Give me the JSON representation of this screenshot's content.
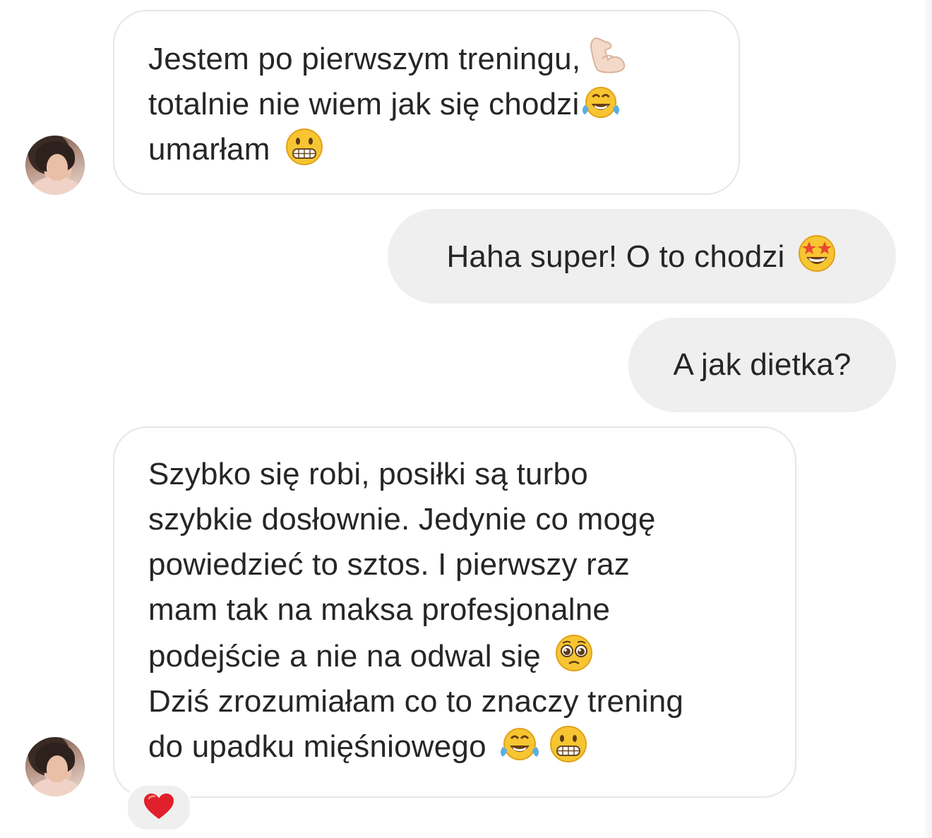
{
  "conversation": {
    "messages": [
      {
        "sender": "other",
        "lines": [
          {
            "text": "Jestem po pierwszym treningu,",
            "emoji": "flexed-biceps-icon"
          },
          {
            "text": "totalnie nie wiem jak się chodzi",
            "emoji": "tears-of-joy-icon"
          },
          {
            "text": "umarłam",
            "emoji": "grimacing-face-icon"
          }
        ]
      },
      {
        "sender": "me",
        "text": "Haha super! O to chodzi",
        "emoji": "star-struck-icon"
      },
      {
        "sender": "me",
        "text": "A jak dietka?"
      },
      {
        "sender": "other",
        "lines": [
          {
            "text": "Szybko się robi, posiłki są turbo"
          },
          {
            "text": "szybkie dosłownie. Jedynie co mogę"
          },
          {
            "text": "powiedzieć to sztos. I pierwszy raz"
          },
          {
            "text": "mam tak na maksa profesjonalne"
          },
          {
            "text": "podejście a nie na odwal się",
            "emoji": "pleading-face-icon"
          },
          {
            "text": "Dziś zrozumiałam co to znaczy trening"
          },
          {
            "text": "do upadku mięśniowego",
            "emoji": [
              "tears-of-joy-icon",
              "grimacing-face-icon"
            ]
          }
        ],
        "reaction": "red-heart-icon"
      }
    ]
  },
  "colors": {
    "sent_bubble": "#efefef",
    "received_border": "#e6e6e6",
    "text": "#262626",
    "heart": "#e0202a"
  }
}
